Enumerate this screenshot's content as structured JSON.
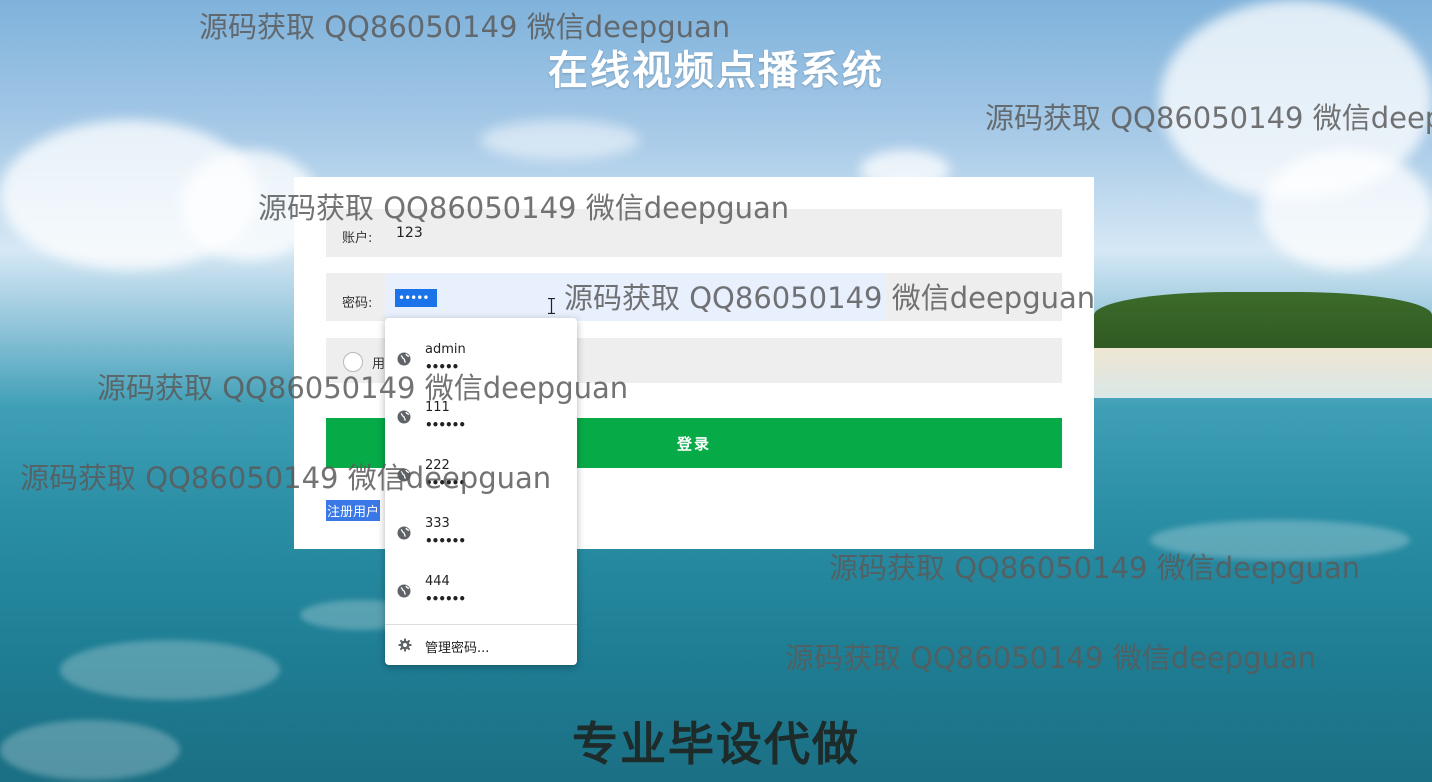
{
  "page": {
    "title": "在线视频点播系统",
    "footer_banner": "专业毕设代做"
  },
  "login_form": {
    "account_label": "账户:",
    "account_value": "123",
    "password_label": "密码:",
    "password_value": "•••••",
    "role_label": "用",
    "login_button": "登录",
    "register_link": "注册用户"
  },
  "password_suggestions": {
    "items": [
      {
        "username": "admin",
        "masked": "•••••"
      },
      {
        "username": "111",
        "masked": "••••••"
      },
      {
        "username": "222",
        "masked": "••••••"
      },
      {
        "username": "333",
        "masked": "••••••"
      },
      {
        "username": "444",
        "masked": "••••••"
      }
    ],
    "manage_label": "管理密码..."
  },
  "watermark": {
    "text": "源码获取 QQ86050149 微信deepguan"
  },
  "colors": {
    "login_button": "#06ab47",
    "field_bg": "#eeeeee",
    "autofill_bg": "#e8f0fe",
    "selection": "#1a73e8"
  },
  "icons": {
    "suggestion": "globe-icon",
    "manage": "gear-icon",
    "cursor": "text-cursor-icon"
  }
}
